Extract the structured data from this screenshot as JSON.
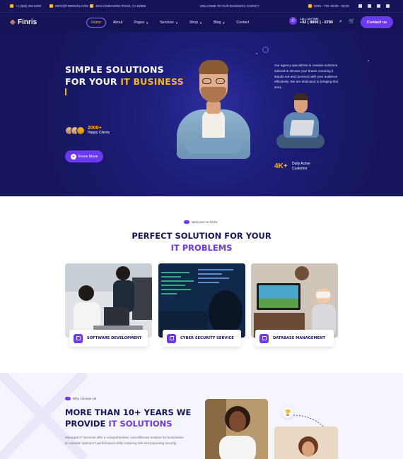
{
  "topbar": {
    "phone": "+1 (555) 250 5290",
    "email": "INFO@FINRISZN.COM",
    "address": "4014 CIMMARON ROAD, CA 92806",
    "welcome": "WELCOME TO OUR BUSINESS AGENCY",
    "hours": "MON - FRI: 09:00 - 05:00"
  },
  "header": {
    "logo_text": "Finris",
    "nav": [
      "Home",
      "About",
      "Pages",
      "Services",
      "Shop",
      "Blog",
      "Contact"
    ],
    "call_label": "CALL ANYTIME",
    "call_number": "+92 ( 8800 ) - 6780",
    "contact_button": "Contact us"
  },
  "hero": {
    "title_line1": "SIMPLE SOLUTIONS",
    "title_line2_prefix": "FOR YOUR ",
    "title_line2_accent": "IT BUSINESS",
    "happy_count": "2000+",
    "happy_label": "Happy Clients",
    "cta": "Know More",
    "description": "Our agency specializes in creative solutions tailored to elevate your brand, ensuring it stands out and connects with your audience effectively. We are dedicated to bringing that story.",
    "active_count": "4K+",
    "active_label": "Daily Active Customer"
  },
  "solutions": {
    "tag": "Welcome to Finris",
    "title_line1": "PERFECT SOLUTION FOR YOUR",
    "title_line2": "IT PROBLEMS",
    "cards": [
      {
        "label": "SOFTWARE DEVELOPMENT"
      },
      {
        "label": "CYBER SECURITY SERVICE"
      },
      {
        "label": "DATABASE MANAGEMENT"
      }
    ]
  },
  "choose": {
    "tag": "Why Choose Us",
    "title_line1": "MORE THAN 10+ YEARS WE",
    "title_line2_prefix": "PROVIDE ",
    "title_line2_accent": "IT SOLUTIONS",
    "text": "Managed IT Services offer a comprehensive, cost-effective solution for businesses to maintain optimal IT performance while reducing risk and improving security."
  },
  "colors": {
    "navy": "#17165c",
    "accent_yellow": "#f5b71b",
    "accent_purple": "#6b3af0"
  }
}
